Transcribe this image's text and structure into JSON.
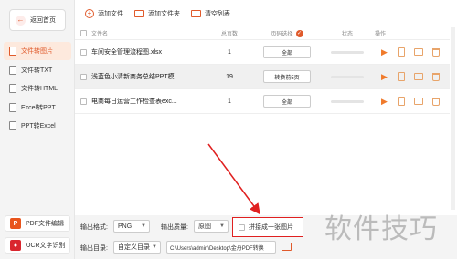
{
  "sidebar": {
    "home_label": "返回首页",
    "items": [
      {
        "label": "文件转图片",
        "active": true
      },
      {
        "label": "文件转TXT",
        "active": false
      },
      {
        "label": "文件转HTML",
        "active": false
      },
      {
        "label": "Excel转PPT",
        "active": false
      },
      {
        "label": "PPT转Excel",
        "active": false
      }
    ],
    "promos": [
      {
        "label": "PDF文件编辑",
        "icon": "pdf-icon",
        "color": "#e8541c"
      },
      {
        "label": "OCR文字识别",
        "icon": "ocr-icon",
        "color": "#d9262e"
      }
    ]
  },
  "toolbar": {
    "add_file": "添加文件",
    "add_folder": "添加文件夹",
    "clear_list": "清空列表"
  },
  "table": {
    "headers": {
      "name": "文件名",
      "pages": "总页数",
      "page_select": "页码选择",
      "status": "状态",
      "ops": "操作"
    },
    "rows": [
      {
        "name": "车间安全管理流程图.xlsx",
        "pages": "1",
        "selection": "全部",
        "selected": false
      },
      {
        "name": "浅蓝色小清新商务总结PPT模...",
        "pages": "19",
        "selection": "转换前5页",
        "selected": true
      },
      {
        "name": "电商每日运营工作检查表exc...",
        "pages": "1",
        "selection": "全部",
        "selected": false
      }
    ]
  },
  "settings": {
    "format_label": "输出格式:",
    "format_value": "PNG",
    "quality_label": "输出质量:",
    "quality_value": "原图",
    "merge_label": "拼接成一张图片",
    "dir_label": "输出目录:",
    "dir_value": "自定义目录",
    "path_value": "C:\\Users\\admin\\Desktop\\金舟PDF转换"
  },
  "colors": {
    "accent": "#e05a2b",
    "highlight_box": "#e02020"
  },
  "watermark": "软件技巧"
}
